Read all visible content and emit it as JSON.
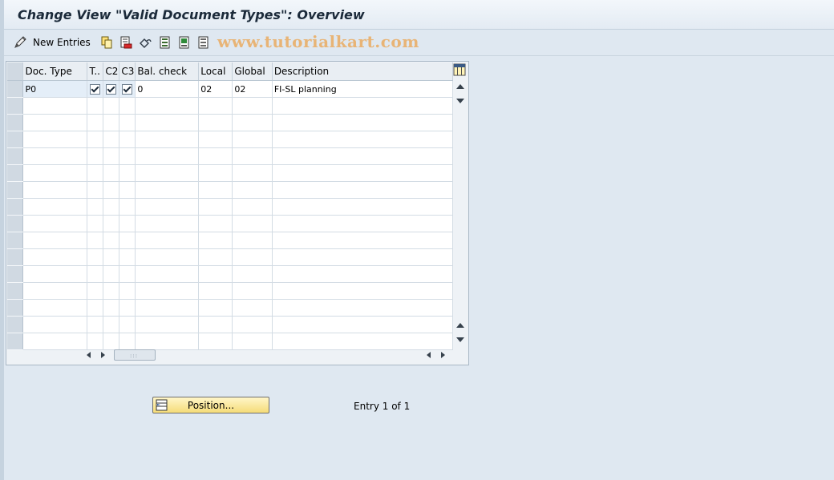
{
  "window": {
    "title": "Change View \"Valid Document Types\": Overview"
  },
  "toolbar": {
    "new_entries_label": "New Entries",
    "watermark": "www.tutorialkart.com"
  },
  "table": {
    "columns": [
      "Doc. Type",
      "T..",
      "C2",
      "C3",
      "Bal. check",
      "Local",
      "Global",
      "Description"
    ],
    "rows": [
      {
        "doc_type": "P0",
        "t": true,
        "c2": true,
        "c3": true,
        "bal_check": "0",
        "local": "02",
        "global": "02",
        "description": "FI-SL planning"
      }
    ],
    "empty_rows": 15
  },
  "footer": {
    "position_label": "Position...",
    "entry_status": "Entry 1 of 1"
  },
  "colors": {
    "background": "#dfe8f1",
    "button_yellow": "#f5dc78",
    "watermark": "#e8b476"
  }
}
